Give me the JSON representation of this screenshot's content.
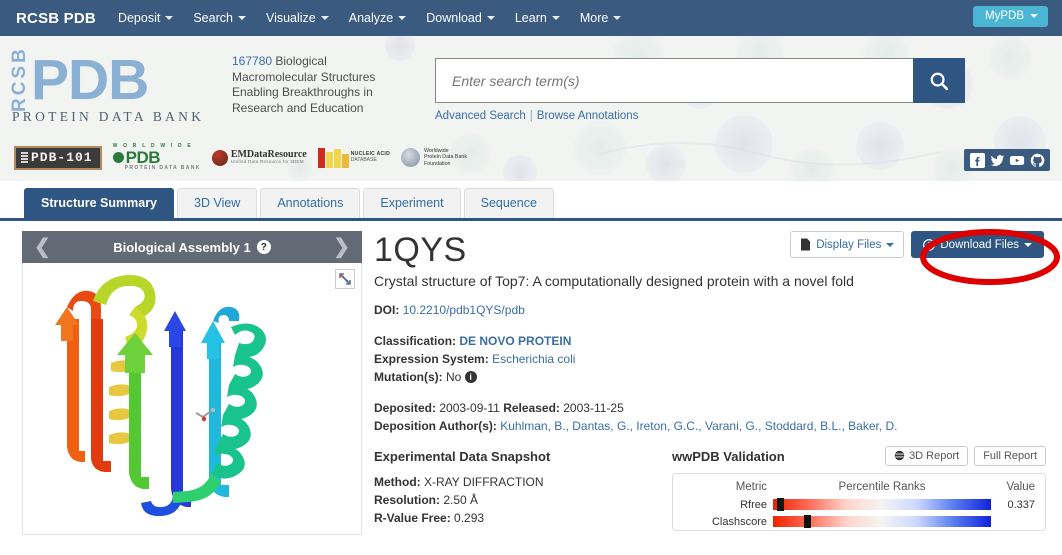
{
  "topnav": {
    "brand": "RCSB PDB",
    "items": [
      {
        "label": "Deposit"
      },
      {
        "label": "Search"
      },
      {
        "label": "Visualize"
      },
      {
        "label": "Analyze"
      },
      {
        "label": "Download"
      },
      {
        "label": "Learn"
      },
      {
        "label": "More"
      }
    ],
    "mypdb_label": "MyPDB",
    "bg_color": "#3a5a80",
    "mypdb_color": "#4bb5d4"
  },
  "header": {
    "logo": {
      "rcsb": "RCSB",
      "pdb": "PDB",
      "subtitle": "PROTEIN DATA BANK",
      "color": "#8ab0d4"
    },
    "tagline": {
      "count": "167780",
      "line1_rest": " Biological",
      "line2": "Macromolecular Structures",
      "line3": "Enabling Breakthroughs in",
      "line4": "Research and Education"
    },
    "search": {
      "placeholder": "Enter search term(s)",
      "value": "",
      "button_icon": "search-icon"
    },
    "sublinks": {
      "advanced": "Advanced Search",
      "separator": "|",
      "browse": "Browse Annotations"
    },
    "partners": [
      {
        "name": "pdb-101",
        "label": "PDB-101"
      },
      {
        "name": "wwpdb",
        "top": "W O R L D W I D E",
        "label": "PDB",
        "bottom": "PROTEIN DATA BANK"
      },
      {
        "name": "emdataresource",
        "label": "EMDataResource",
        "sub": "Unified Data Resource for 3DEM"
      },
      {
        "name": "nucleic-acid-database",
        "line1": "NUCLEIC ACID",
        "line2": "DATABASE"
      },
      {
        "name": "wwpdb-foundation",
        "line1": "Worldwide",
        "line2": "Protein Data Bank",
        "line3": "Foundation"
      }
    ],
    "social": [
      {
        "name": "facebook-icon",
        "glyph": "f"
      },
      {
        "name": "twitter-icon",
        "glyph": "t"
      },
      {
        "name": "youtube-icon",
        "glyph": "y"
      },
      {
        "name": "github-icon",
        "glyph": "g"
      }
    ]
  },
  "tabs": [
    {
      "label": "Structure Summary",
      "active": true
    },
    {
      "label": "3D View",
      "active": false
    },
    {
      "label": "Annotations",
      "active": false
    },
    {
      "label": "Experiment",
      "active": false
    },
    {
      "label": "Sequence",
      "active": false
    }
  ],
  "viewer": {
    "title": "Biological Assembly 1",
    "help_glyph": "?",
    "prev_glyph": "❮",
    "next_glyph": "❯",
    "expand_icon": "expand-icon"
  },
  "actions": {
    "display_files": "Display Files",
    "download_files": "Download Files"
  },
  "entry": {
    "pdb_id": "1QYS",
    "title": "Crystal structure of Top7: A computationally designed protein with a novel fold",
    "doi_label": "DOI:",
    "doi_value": "10.2210/pdb1QYS/pdb",
    "classification_label": "Classification:",
    "classification_value": "DE NOVO PROTEIN",
    "expression_label": "Expression System:",
    "expression_value": "Escherichia coli",
    "mutation_label": "Mutation(s):",
    "mutation_value": "No",
    "deposited_label": "Deposited:",
    "deposited_value": "2003-09-11",
    "released_label": "Released:",
    "released_value": "2003-11-25",
    "authors_label": "Deposition Author(s):",
    "authors_value": "Kuhlman, B., Dantas, G., Ireton, G.C., Varani, G., Stoddard, B.L., Baker, D."
  },
  "experimental": {
    "title": "Experimental Data Snapshot",
    "rows": [
      {
        "label": "Method:",
        "value": "X-RAY DIFFRACTION"
      },
      {
        "label": "Resolution:",
        "value": "2.50 Å"
      },
      {
        "label": "R-Value Free:",
        "value": "0.293"
      }
    ]
  },
  "validation": {
    "title": "wwPDB Validation",
    "report_3d": "3D Report",
    "report_full": "Full Report",
    "columns": {
      "metric": "Metric",
      "rank": "Percentile Ranks",
      "value": "Value"
    },
    "rows": [
      {
        "metric": "Rfree",
        "value": "0.337",
        "percentile": 2
      },
      {
        "metric": "Clashscore",
        "value": "",
        "percentile": 14
      }
    ]
  },
  "annotation": {
    "shape": "ellipse",
    "color": "#dd0000",
    "target": "download-files-button"
  }
}
